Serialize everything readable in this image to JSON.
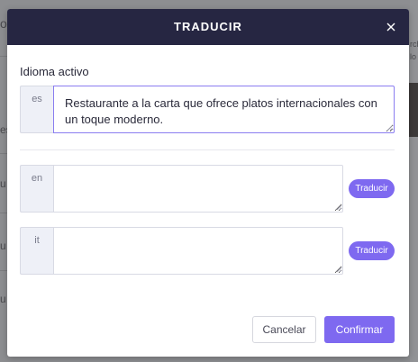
{
  "background": {
    "fragments": [
      "o",
      "es",
      "u",
      "u",
      "u",
      "rch",
      "lo"
    ]
  },
  "modal": {
    "title": "TRADUCIR",
    "close_icon": "close-icon",
    "section_label": "Idioma activo",
    "active_language": {
      "code": "es",
      "text": "Restaurante a la carta que ofrece platos internacionales con un toque moderno."
    },
    "languages": [
      {
        "code": "en",
        "text": "",
        "button_label": "Traducir"
      },
      {
        "code": "it",
        "text": "",
        "button_label": "Traducir"
      }
    ],
    "buttons": {
      "cancel": "Cancelar",
      "confirm": "Confirmar"
    }
  },
  "colors": {
    "header_bg": "#262642",
    "accent": "#7e69f0",
    "overlay": "#8d8e91"
  }
}
